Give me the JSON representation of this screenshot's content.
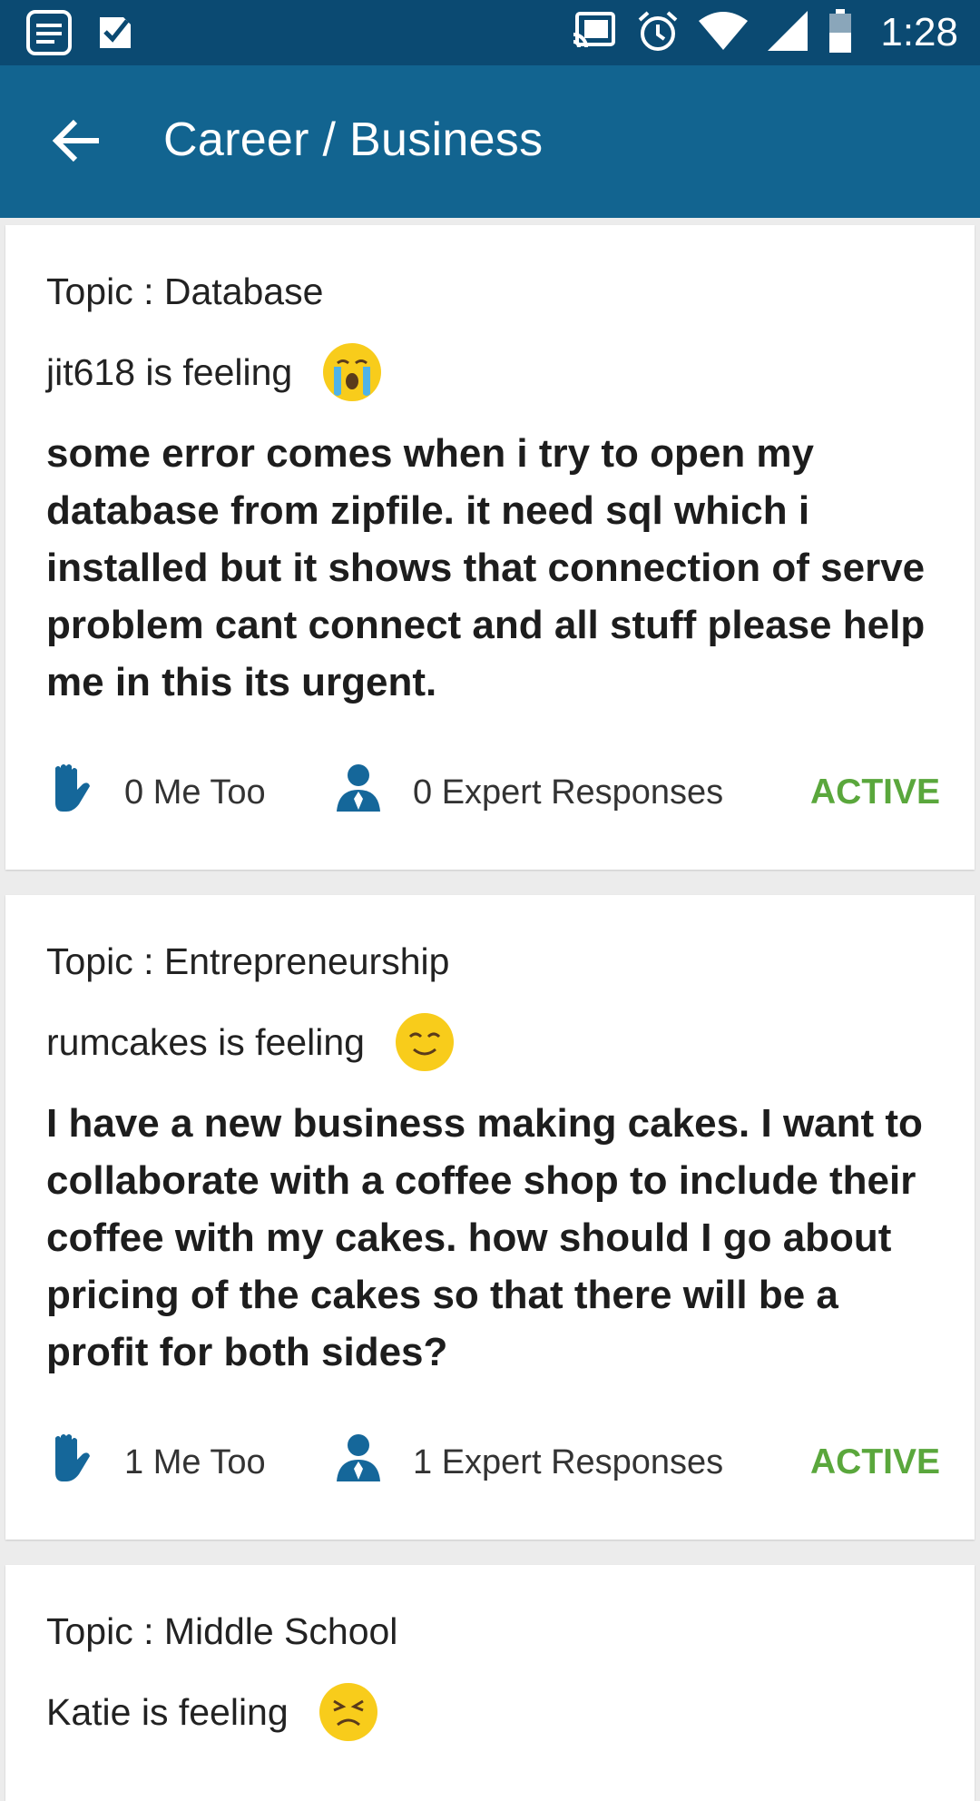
{
  "status_bar": {
    "time": "1:28",
    "icons": [
      "notes-icon",
      "check-icon",
      "cast-icon",
      "alarm-icon",
      "wifi-icon",
      "signal-icon",
      "battery-icon"
    ]
  },
  "app_bar": {
    "title": "Career / Business",
    "back_icon": "arrow-left-icon",
    "color": "#126490"
  },
  "posts": [
    {
      "topic": "Topic : Database",
      "feeling": "jit618 is feeling",
      "emoji": "crying-face",
      "question": "some error comes when i try to open my database from zipfile. it need sql which i installed but it shows that connection of serve problem cant connect and all stuff please help me in this its urgent.",
      "me_too": "0 Me Too",
      "expert_responses": "0 Expert Responses",
      "status": "ACTIVE"
    },
    {
      "topic": "Topic : Entrepreneurship",
      "feeling": "rumcakes is feeling",
      "emoji": "smiling-face",
      "question": "I have a new business making cakes.  I want to collaborate with a coffee shop to include their coffee with my cakes.  how should I go about pricing of the cakes so that there will be a profit for both sides?",
      "me_too": "1 Me Too",
      "expert_responses": "1 Expert Responses",
      "status": "ACTIVE"
    },
    {
      "topic": "Topic : Middle School",
      "feeling": "Katie is feeling",
      "emoji": "persevering-face"
    }
  ],
  "colors": {
    "status_bar": "#0b4a72",
    "active": "#5aa73c",
    "icon_blue": "#15679a",
    "emoji_yellow": "#f8cc1b"
  }
}
